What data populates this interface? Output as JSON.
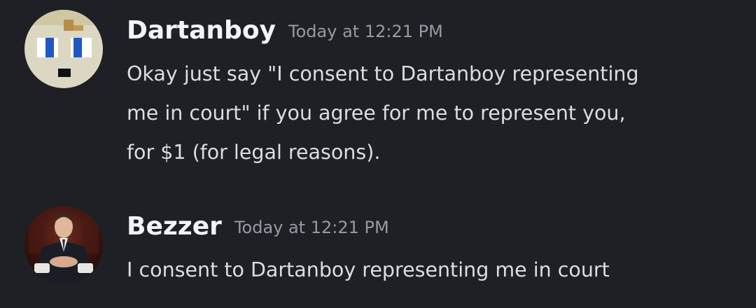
{
  "messages": [
    {
      "author": "Dartanboy",
      "timestamp": "Today at 12:21 PM",
      "avatar_icon": "pixel-face-avatar",
      "lines": [
        "Okay just say \"I consent to Dartanboy representing",
        "me in court\" if you agree for me to represent you,",
        "for $1 (for legal reasons)."
      ]
    },
    {
      "author": "Bezzer",
      "timestamp": "Today at 12:21 PM",
      "avatar_icon": "person-photo-avatar",
      "lines": [
        "I consent to Dartanboy representing me in court"
      ]
    }
  ],
  "colors": {
    "background": "#1f2025",
    "username": "#f2f3f5",
    "timestamp": "#949ba4",
    "text": "#dbdee1"
  }
}
